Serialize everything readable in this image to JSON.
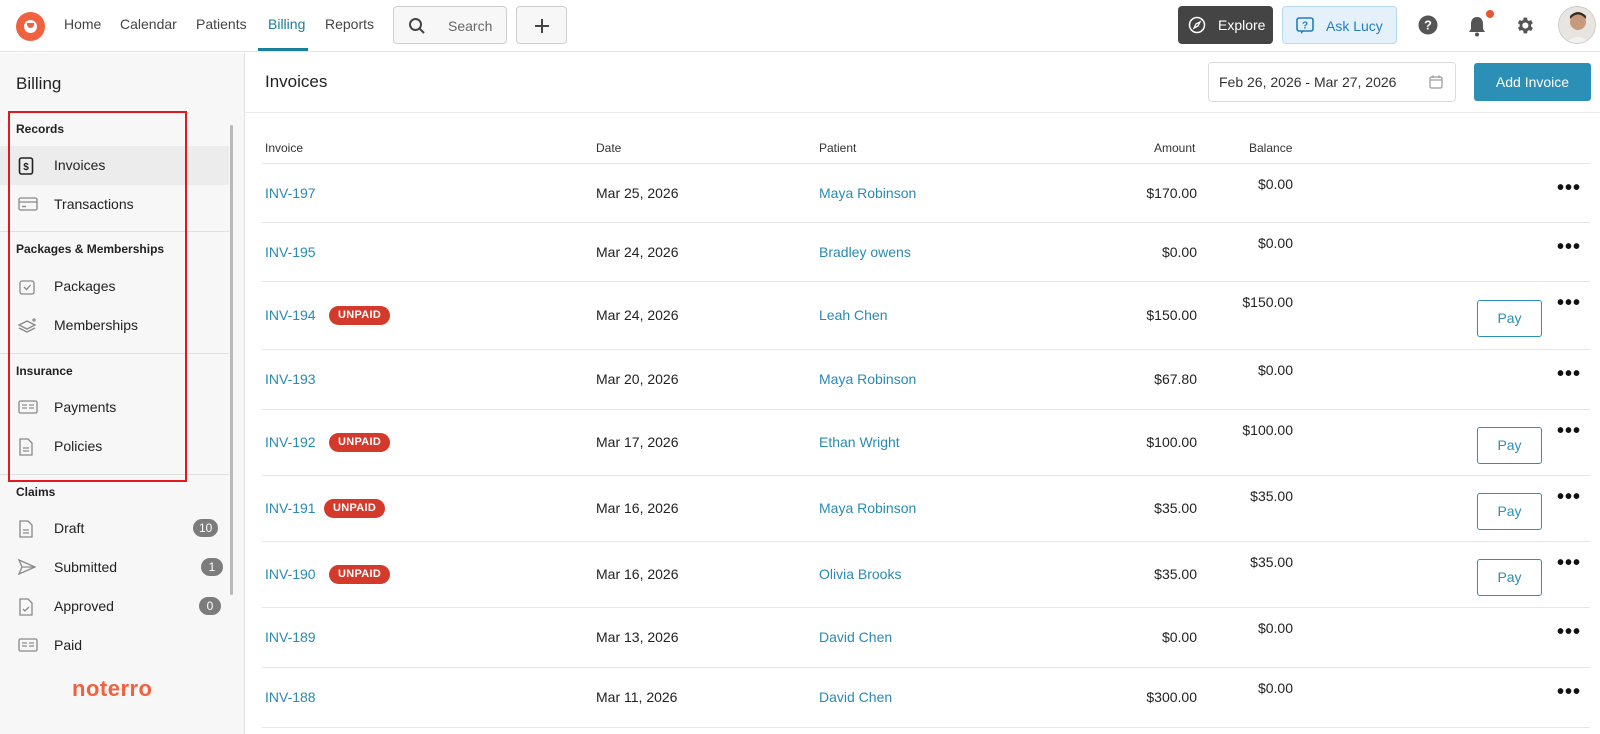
{
  "nav": {
    "items": [
      "Home",
      "Calendar",
      "Patients",
      "Billing",
      "Reports"
    ],
    "active": "Billing",
    "search_label": "Search",
    "explore_label": "Explore",
    "ask_lucy_label": "Ask Lucy"
  },
  "sidebar": {
    "title": "Billing",
    "sections": [
      {
        "heading": "Records",
        "items": [
          {
            "label": "Invoices"
          },
          {
            "label": "Transactions"
          }
        ]
      },
      {
        "heading": "Packages & Memberships",
        "items": [
          {
            "label": "Packages"
          },
          {
            "label": "Memberships"
          }
        ]
      },
      {
        "heading": "Insurance",
        "items": [
          {
            "label": "Payments"
          },
          {
            "label": "Policies"
          }
        ]
      },
      {
        "heading": "Claims",
        "items": [
          {
            "label": "Draft",
            "badge": "10"
          },
          {
            "label": "Submitted",
            "badge": "1"
          },
          {
            "label": "Approved",
            "badge": "0"
          },
          {
            "label": "Paid"
          }
        ]
      }
    ],
    "brand": "noterro"
  },
  "main": {
    "title": "Invoices",
    "date_range": "Feb 26, 2026 - Mar 27, 2026",
    "add_invoice_label": "Add Invoice",
    "columns": {
      "invoice": "Invoice",
      "date": "Date",
      "patient": "Patient",
      "amount": "Amount",
      "balance": "Balance"
    },
    "unpaid_label": "UNPAID",
    "pay_label": "Pay",
    "rows": [
      {
        "invoice": "INV-197",
        "date": "Mar 25, 2026",
        "patient": "Maya Robinson",
        "amount": "$170.00",
        "balance": "$0.00",
        "unpaid": false
      },
      {
        "invoice": "INV-195",
        "date": "Mar 24, 2026",
        "patient": "Bradley owens",
        "amount": "$0.00",
        "balance": "$0.00",
        "unpaid": false
      },
      {
        "invoice": "INV-194",
        "date": "Mar 24, 2026",
        "patient": "Leah Chen",
        "amount": "$150.00",
        "balance": "$150.00",
        "unpaid": true
      },
      {
        "invoice": "INV-193",
        "date": "Mar 20, 2026",
        "patient": "Maya Robinson",
        "amount": "$67.80",
        "balance": "$0.00",
        "unpaid": false
      },
      {
        "invoice": "INV-192",
        "date": "Mar 17, 2026",
        "patient": "Ethan Wright",
        "amount": "$100.00",
        "balance": "$100.00",
        "unpaid": true
      },
      {
        "invoice": "INV-191",
        "date": "Mar 16, 2026",
        "patient": "Maya Robinson",
        "amount": "$35.00",
        "balance": "$35.00",
        "unpaid": true
      },
      {
        "invoice": "INV-190",
        "date": "Mar 16, 2026",
        "patient": "Olivia Brooks",
        "amount": "$35.00",
        "balance": "$35.00",
        "unpaid": true
      },
      {
        "invoice": "INV-189",
        "date": "Mar 13, 2026",
        "patient": "David Chen",
        "amount": "$0.00",
        "balance": "$0.00",
        "unpaid": false
      },
      {
        "invoice": "INV-188",
        "date": "Mar 11, 2026",
        "patient": "David Chen",
        "amount": "$300.00",
        "balance": "$0.00",
        "unpaid": false
      }
    ]
  },
  "colors": {
    "accent": "#2c8fb5",
    "brand": "#f0623f",
    "unpaid": "#d33a2c"
  }
}
